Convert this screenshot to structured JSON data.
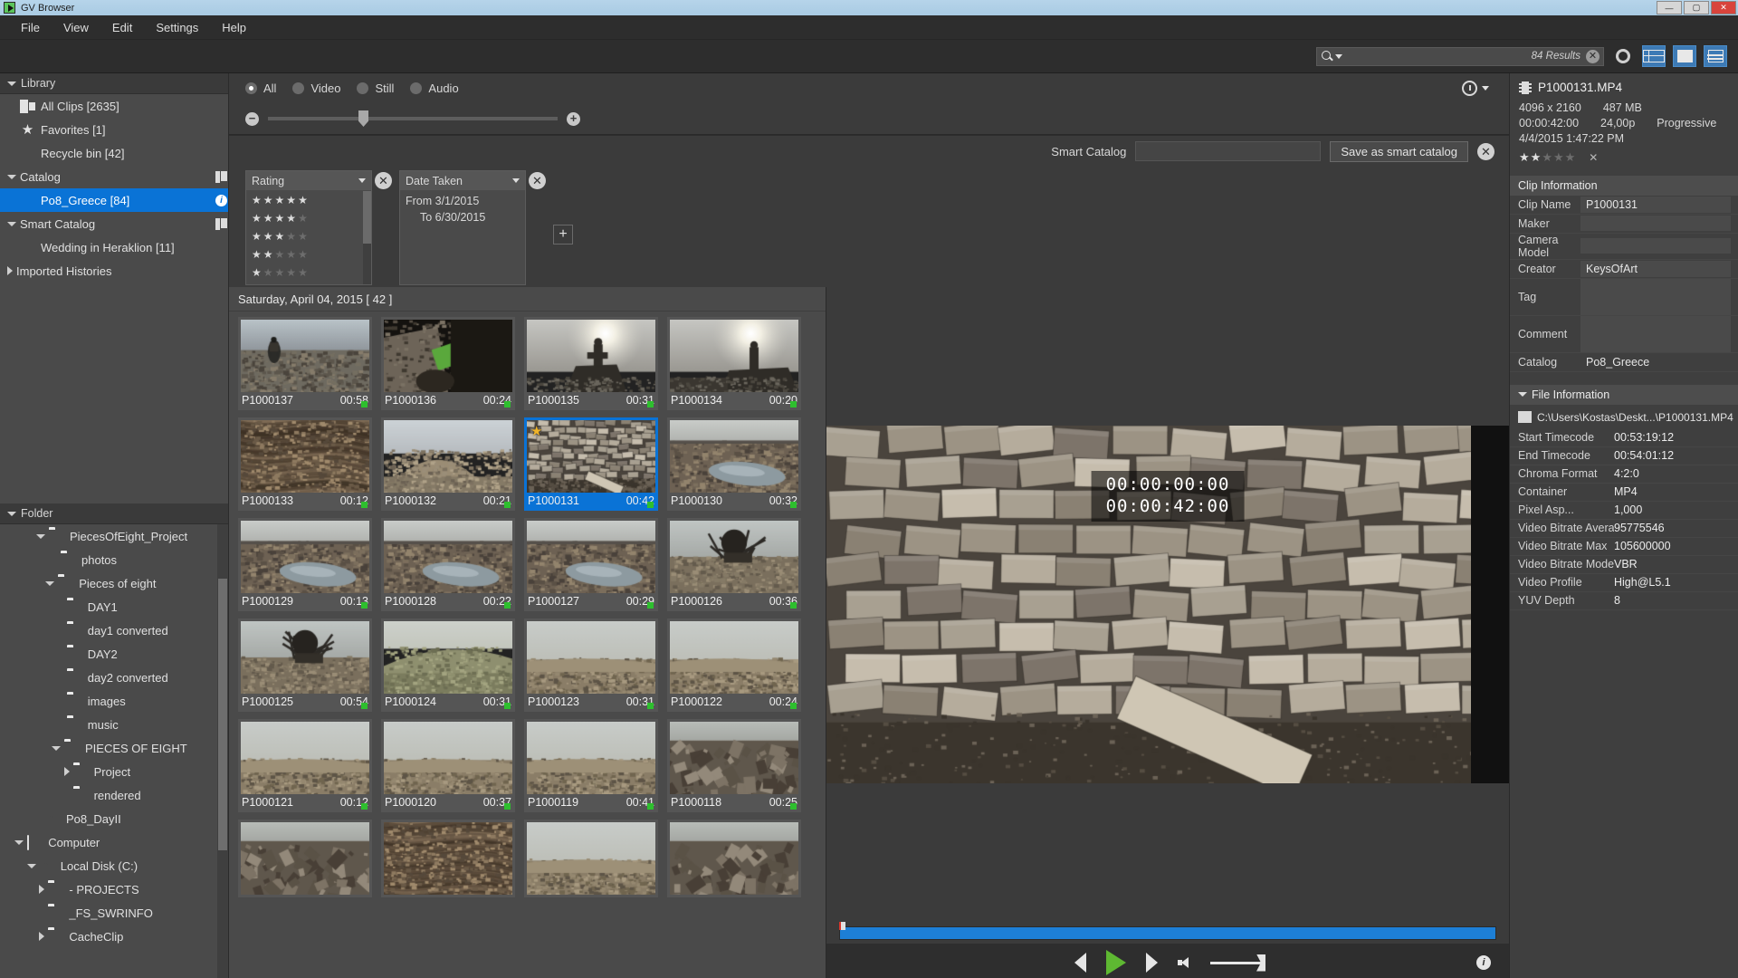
{
  "window": {
    "title": "GV Browser",
    "minimize": "—",
    "maximize": "▢",
    "close": "✕"
  },
  "menubar": [
    "File",
    "View",
    "Edit",
    "Settings",
    "Help"
  ],
  "toolbar": {
    "search_placeholder": "",
    "results_label": "84 Results",
    "clear_label": "✕",
    "icons": [
      "gear-icon",
      "grid-view-icon",
      "filmstrip-view-icon",
      "list-view-icon"
    ]
  },
  "sidebar": {
    "library_header": "Library",
    "library_items": [
      {
        "label": "All Clips [2635]",
        "icon": "clips-icon",
        "selected": false,
        "indent": 1
      },
      {
        "label": "Favorites [1]",
        "icon": "star-icon",
        "selected": false,
        "indent": 1
      },
      {
        "label": "Recycle bin [42]",
        "icon": "recycle-bin-icon",
        "selected": false,
        "indent": 1
      }
    ],
    "catalog_header": "Catalog",
    "catalog_items": [
      {
        "label": "Po8_Greece [84]",
        "icon": "book-icon",
        "selected": true,
        "indent": 1
      }
    ],
    "smart_catalog_header": "Smart Catalog",
    "smart_catalog_items": [
      {
        "label": "Wedding in Heraklion [11]",
        "icon": "book-icon",
        "selected": false,
        "indent": 1
      }
    ],
    "imported_header": "Imported Histories",
    "folder_header": "Folder",
    "folder_items": [
      {
        "label": "PiecesOfEight_Project",
        "indent": 2,
        "expander": "down",
        "icon": "folder-open-icon"
      },
      {
        "label": "photos",
        "indent": 3,
        "expander": "none",
        "icon": "folder-icon"
      },
      {
        "label": "Pieces of eight",
        "indent": 2.6,
        "expander": "down",
        "icon": "folder-open-icon"
      },
      {
        "label": "DAY1",
        "indent": 3.4,
        "expander": "none",
        "icon": "folder-icon"
      },
      {
        "label": "day1 converted",
        "indent": 3.4,
        "expander": "none",
        "icon": "folder-icon"
      },
      {
        "label": "DAY2",
        "indent": 3.4,
        "expander": "none",
        "icon": "folder-icon"
      },
      {
        "label": "day2 converted",
        "indent": 3.4,
        "expander": "none",
        "icon": "folder-icon"
      },
      {
        "label": "images",
        "indent": 3.4,
        "expander": "none",
        "icon": "folder-icon"
      },
      {
        "label": "music",
        "indent": 3.4,
        "expander": "none",
        "icon": "folder-icon"
      },
      {
        "label": "PIECES OF EIGHT",
        "indent": 3.0,
        "expander": "down",
        "icon": "folder-open-icon"
      },
      {
        "label": "Project",
        "indent": 3.8,
        "expander": "right",
        "icon": "folder-icon"
      },
      {
        "label": "rendered",
        "indent": 3.8,
        "expander": "none",
        "icon": "folder-icon"
      },
      {
        "label": "Po8_DayII",
        "indent": 2.0,
        "expander": "none",
        "icon": "disk-icon"
      },
      {
        "label": "Computer",
        "indent": 0.6,
        "expander": "down",
        "icon": "computer-icon"
      },
      {
        "label": "Local Disk (C:)",
        "indent": 1.4,
        "expander": "down",
        "icon": "disk-icon"
      },
      {
        "label": "- PROJECTS",
        "indent": 2.2,
        "expander": "right",
        "icon": "folder-icon"
      },
      {
        "label": "_FS_SWRINFO",
        "indent": 2.2,
        "expander": "none",
        "icon": "folder-icon"
      },
      {
        "label": "CacheClip",
        "indent": 2.2,
        "expander": "right",
        "icon": "folder-icon"
      }
    ]
  },
  "filters": {
    "types": [
      {
        "label": "All",
        "selected": true
      },
      {
        "label": "Video",
        "selected": false
      },
      {
        "label": "Still",
        "selected": false
      },
      {
        "label": "Audio",
        "selected": false
      }
    ],
    "zoom_minus": "−",
    "zoom_plus": "+",
    "smart_catalog_label": "Smart Catalog",
    "smart_catalog_value": "",
    "save_button": "Save as smart catalog",
    "clear_all": "✕",
    "add_criterion": "+",
    "criteria": [
      {
        "name": "Rating",
        "type": "rating",
        "rows": [
          {
            "filled": 5
          },
          {
            "filled": 4
          },
          {
            "filled": 3
          },
          {
            "filled": 2
          },
          {
            "filled": 1
          }
        ]
      },
      {
        "name": "Date Taken",
        "type": "date",
        "from": "From 3/1/2015",
        "to": "To 6/30/2015"
      }
    ]
  },
  "browser": {
    "date_header": "Saturday, April 04, 2015 [ 42 ]",
    "clips": [
      {
        "name": "P1000137",
        "duration": "00:58",
        "selected": false,
        "favorite": false,
        "thumb": "hiker"
      },
      {
        "name": "P1000136",
        "duration": "00:24",
        "selected": false,
        "favorite": false,
        "thumb": "slate"
      },
      {
        "name": "P1000135",
        "duration": "00:31",
        "selected": false,
        "favorite": false,
        "thumb": "sunsit"
      },
      {
        "name": "P1000134",
        "duration": "00:20",
        "selected": false,
        "favorite": false,
        "thumb": "sunsit2"
      },
      {
        "name": "P1000133",
        "duration": "00:12",
        "selected": false,
        "favorite": false,
        "thumb": "dirt"
      },
      {
        "name": "P1000132",
        "duration": "00:21",
        "selected": false,
        "favorite": false,
        "thumb": "mound"
      },
      {
        "name": "P1000131",
        "duration": "00:42",
        "selected": true,
        "favorite": true,
        "thumb": "blocks"
      },
      {
        "name": "P1000130",
        "duration": "00:32",
        "selected": false,
        "favorite": false,
        "thumb": "puddle"
      },
      {
        "name": "P1000129",
        "duration": "00:13",
        "selected": false,
        "favorite": false,
        "thumb": "puddle"
      },
      {
        "name": "P1000128",
        "duration": "00:22",
        "selected": false,
        "favorite": false,
        "thumb": "puddle"
      },
      {
        "name": "P1000127",
        "duration": "00:29",
        "selected": false,
        "favorite": false,
        "thumb": "puddle"
      },
      {
        "name": "P1000126",
        "duration": "00:36",
        "selected": false,
        "favorite": false,
        "thumb": "machine"
      },
      {
        "name": "P1000125",
        "duration": "00:54",
        "selected": false,
        "favorite": false,
        "thumb": "machine"
      },
      {
        "name": "P1000124",
        "duration": "00:31",
        "selected": false,
        "favorite": false,
        "thumb": "hill"
      },
      {
        "name": "P1000123",
        "duration": "00:31",
        "selected": false,
        "favorite": false,
        "thumb": "desert"
      },
      {
        "name": "P1000122",
        "duration": "00:24",
        "selected": false,
        "favorite": false,
        "thumb": "desert"
      },
      {
        "name": "P1000121",
        "duration": "00:12",
        "selected": false,
        "favorite": false,
        "thumb": "desert"
      },
      {
        "name": "P1000120",
        "duration": "00:37",
        "selected": false,
        "favorite": false,
        "thumb": "desert"
      },
      {
        "name": "P1000119",
        "duration": "00:41",
        "selected": false,
        "favorite": false,
        "thumb": "desert"
      },
      {
        "name": "P1000118",
        "duration": "00:25",
        "selected": false,
        "favorite": false,
        "thumb": "rocks"
      },
      {
        "name": "",
        "duration": "",
        "selected": false,
        "favorite": false,
        "thumb": "rocks"
      },
      {
        "name": "",
        "duration": "",
        "selected": false,
        "favorite": false,
        "thumb": "dirt"
      },
      {
        "name": "",
        "duration": "",
        "selected": false,
        "favorite": false,
        "thumb": "desert"
      },
      {
        "name": "",
        "duration": "",
        "selected": false,
        "favorite": false,
        "thumb": "rocks"
      }
    ]
  },
  "player": {
    "timecode_current": "00:00:00:00",
    "timecode_total": "00:00:42:00",
    "prev_label": "◀",
    "play_label": "▶",
    "next_label": "▶",
    "mute_label": "speaker-icon",
    "info_label": "i"
  },
  "rightpanel": {
    "file_title": "P1000131.MP4",
    "resolution": "4096 x 2160",
    "filesize": "487 MB",
    "duration": "00:00:42:00",
    "framerate": "24,00p",
    "scan": "Progressive",
    "datetime": "4/4/2015 1:47:22 PM",
    "rating_filled": 2,
    "rating_total": 5,
    "rating_clear": "✕",
    "clip_information_header": "Clip Information",
    "clip_fields": [
      {
        "key": "Clip Name",
        "value": "P1000131",
        "tall": false
      },
      {
        "key": "Maker",
        "value": "",
        "tall": false
      },
      {
        "key": "Camera Model",
        "value": "",
        "tall": false
      },
      {
        "key": "Creator",
        "value": "KeysOfArt",
        "tall": false
      },
      {
        "key": "Tag",
        "value": "",
        "tall": true
      },
      {
        "key": "Comment",
        "value": "",
        "tall": true
      },
      {
        "key": "Catalog",
        "value": "Po8_Greece",
        "tall": false,
        "plain": true
      }
    ],
    "file_information_header": "File Information",
    "file_path": "C:\\Users\\Kostas\\Deskt...\\P1000131.MP4",
    "file_fields": [
      {
        "key": "Start Timecode",
        "value": "00:53:19:12"
      },
      {
        "key": "End Timecode",
        "value": "00:54:01:12"
      },
      {
        "key": "Chroma Format",
        "value": "4:2:0"
      },
      {
        "key": "Container",
        "value": "MP4"
      },
      {
        "key": "Pixel Asp...",
        "value": "1,000"
      },
      {
        "key": "Video Bitrate Avera...",
        "value": "95775546"
      },
      {
        "key": "Video Bitrate Max",
        "value": "105600000"
      },
      {
        "key": "Video Bitrate Mode",
        "value": "VBR"
      },
      {
        "key": "Video Profile",
        "value": "High@L5.1"
      },
      {
        "key": "YUV Depth",
        "value": "8"
      }
    ]
  },
  "colors": {
    "accent": "#0a73d6",
    "play_green": "#5eb832",
    "status_green": "#2ebf2e",
    "favorite_gold": "#f0b429",
    "titlebar": "#b6d4ea"
  }
}
